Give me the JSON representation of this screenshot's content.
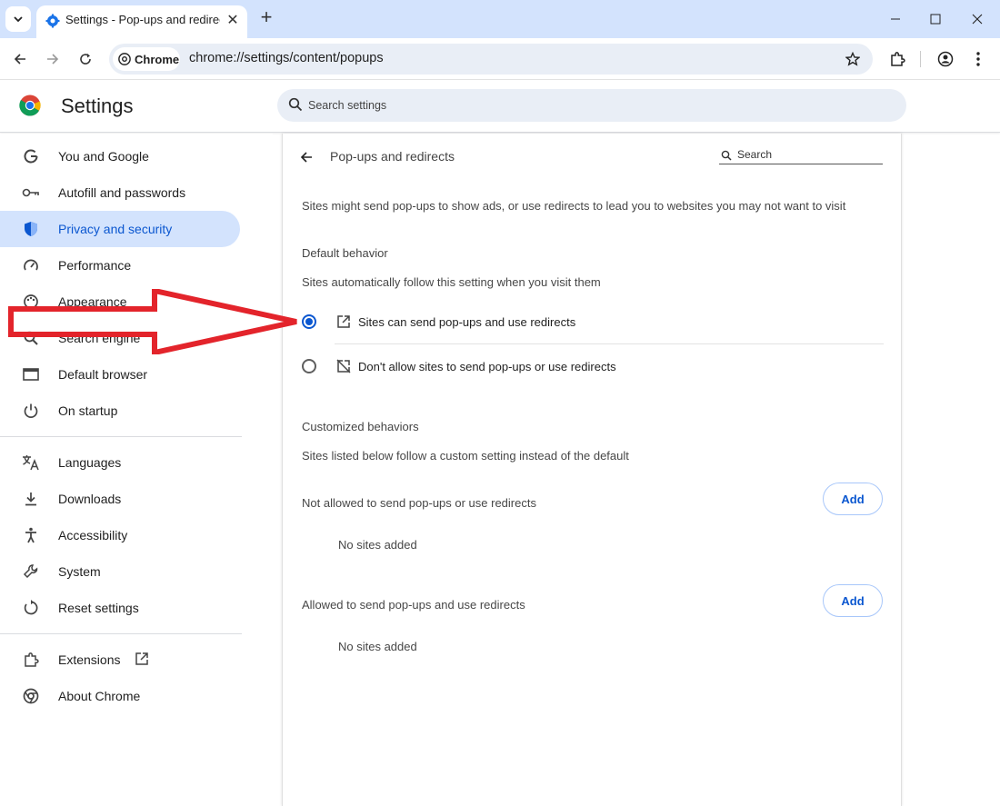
{
  "browser": {
    "tab_title": "Settings - Pop-ups and redirects",
    "url": "chrome://settings/content/popups",
    "chip_label": "Chrome"
  },
  "settings": {
    "title": "Settings",
    "search_placeholder": "Search settings"
  },
  "sidebar": {
    "items": [
      {
        "label": "You and Google",
        "icon": "google-icon"
      },
      {
        "label": "Autofill and passwords",
        "icon": "key-icon"
      },
      {
        "label": "Privacy and security",
        "icon": "shield-icon",
        "active": true
      },
      {
        "label": "Performance",
        "icon": "speedometer-icon"
      },
      {
        "label": "Appearance",
        "icon": "palette-icon"
      },
      {
        "label": "Search engine",
        "icon": "search-icon"
      },
      {
        "label": "Default browser",
        "icon": "browser-window-icon"
      },
      {
        "label": "On startup",
        "icon": "power-icon"
      },
      {
        "label": "Languages",
        "icon": "translate-icon"
      },
      {
        "label": "Downloads",
        "icon": "download-icon"
      },
      {
        "label": "Accessibility",
        "icon": "accessibility-icon"
      },
      {
        "label": "System",
        "icon": "wrench-icon"
      },
      {
        "label": "Reset settings",
        "icon": "reset-icon"
      },
      {
        "label": "Extensions",
        "icon": "puzzle-icon"
      },
      {
        "label": "About Chrome",
        "icon": "chrome-icon"
      }
    ]
  },
  "page": {
    "title": "Pop-ups and redirects",
    "search_label": "Search",
    "description": "Sites might send pop-ups to show ads, or use redirects to lead you to websites you may not want to visit",
    "default_heading": "Default behavior",
    "default_sub": "Sites automatically follow this setting when you visit them",
    "option_allow": "Sites can send pop-ups and use redirects",
    "option_block": "Don't allow sites to send pop-ups or use redirects",
    "custom_heading": "Customized behaviors",
    "custom_sub": "Sites listed below follow a custom setting instead of the default",
    "not_allowed_label": "Not allowed to send pop-ups or use redirects",
    "allowed_label": "Allowed to send pop-ups and use redirects",
    "no_sites": "No sites added",
    "add_label": "Add"
  },
  "colors": {
    "accent": "#0b57d0",
    "active_bg": "#d3e3fd",
    "annotation_arrow": "#e3242b"
  }
}
